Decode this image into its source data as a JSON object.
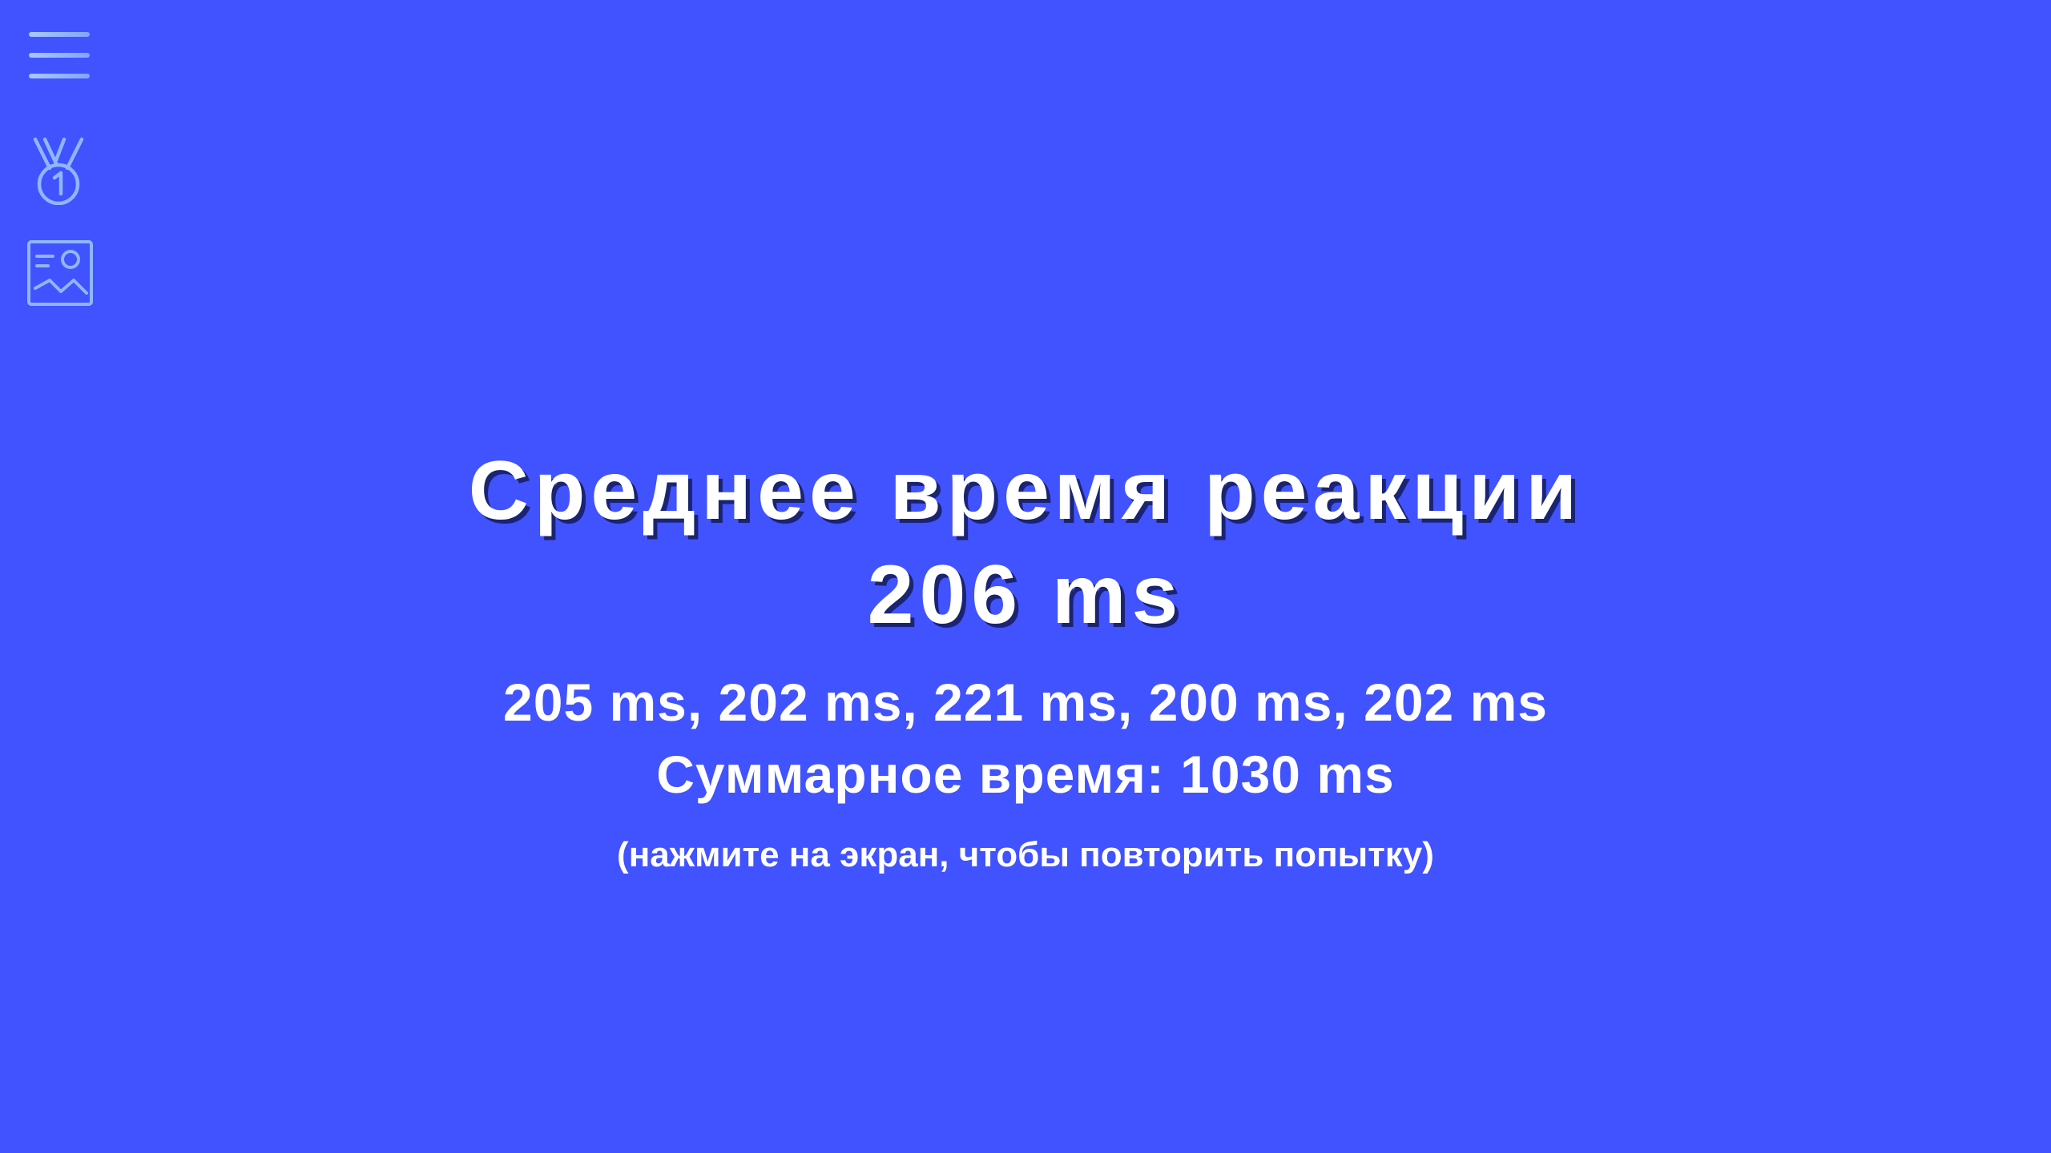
{
  "sidebar": {
    "icons": [
      "menu-icon",
      "medal-icon",
      "gallery-icon"
    ],
    "icon_color": "#8fb7ff"
  },
  "result": {
    "title": "Среднее время реакции",
    "average": "206 ms",
    "attempts": "205 ms, 202 ms, 221 ms, 200 ms, 202 ms",
    "total": "Суммарное время: 1030 ms",
    "hint": "(нажмите на экран, чтобы повторить попытку)"
  },
  "colors": {
    "background": "#4152ff",
    "text": "#ffffff",
    "text_shadow": "#1a2473"
  }
}
